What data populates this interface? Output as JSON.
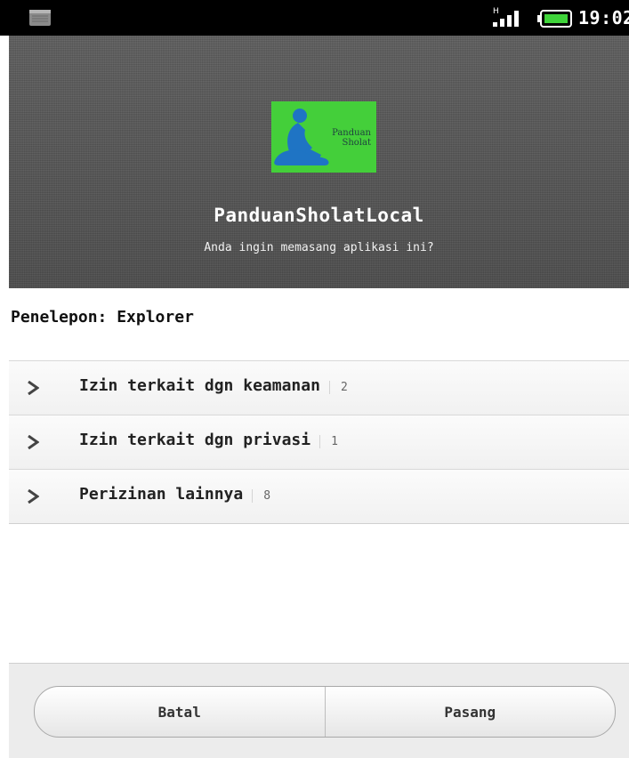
{
  "status_bar": {
    "time": "19:02",
    "network_type": "H",
    "icons": [
      "sd-card-icon",
      "signal-icon",
      "battery-icon"
    ]
  },
  "header": {
    "app_icon_text": [
      "Panduan",
      "Sholat"
    ],
    "app_name": "PanduanSholatLocal",
    "question": "Anda ingin memasang aplikasi ini?"
  },
  "caller": "Penelepon: Explorer",
  "permissions": [
    {
      "label": "Izin terkait dgn keamanan",
      "count": "2"
    },
    {
      "label": "Izin terkait dgn privasi",
      "count": "1"
    },
    {
      "label": "Perizinan lainnya",
      "count": "8"
    }
  ],
  "buttons": {
    "cancel": "Batal",
    "install": "Pasang"
  },
  "colors": {
    "header_bg": "#555555",
    "icon_bg": "#44cf3a",
    "status_bar_bg": "#000000"
  }
}
